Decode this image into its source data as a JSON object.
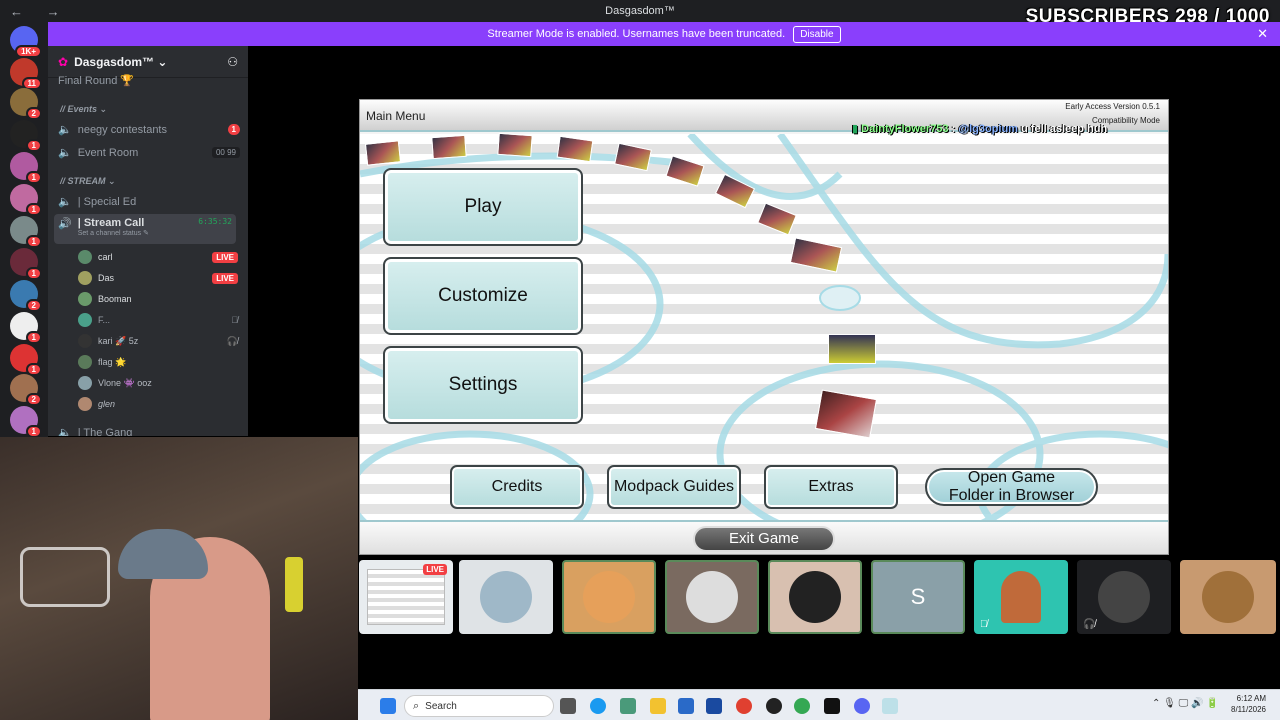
{
  "window": {
    "title": "Dasgasdom™",
    "nav_arrows": "← →"
  },
  "overlay": {
    "subscribers": "SUBSCRIBERS 298 / 1000"
  },
  "streamer_bar": {
    "text": "Streamer Mode is enabled. Usernames have been truncated.",
    "button": "Disable",
    "close": "✕"
  },
  "rail": {
    "badges": [
      "1K+",
      "11",
      "2",
      "1",
      "1",
      "1",
      "1",
      "1",
      "2",
      "1",
      "1",
      "2",
      "1"
    ]
  },
  "guild": {
    "name": "Dasgasdom™ ⌄"
  },
  "channels": {
    "final_round": "Final Round 🏆",
    "events_cat": "// Events ⌄",
    "neegy": "neegy contestants",
    "neegy_badge": "1",
    "event_room": "Event Room",
    "event_room_counts": "00  99",
    "stream_cat": "// STREAM ⌄",
    "special_ed": "|  Special Ed",
    "stream_call": "|  Stream Call",
    "stream_call_time": "6:35:32",
    "stream_call_status": "Set a channel status ✎",
    "the_gang": "|  The Gang"
  },
  "voice_users": [
    {
      "name": "carl",
      "badge": "LIVE"
    },
    {
      "name": "Das",
      "badge": "LIVE"
    },
    {
      "name": "Booman",
      "badge": ""
    },
    {
      "name": "F...",
      "badge": ""
    },
    {
      "name": "kari 🚀 5z",
      "badge": ""
    },
    {
      "name": "flag 🌟",
      "badge": ""
    },
    {
      "name": "Vlone 👾 ooz",
      "badge": ""
    },
    {
      "name": "glen",
      "badge": ""
    }
  ],
  "game": {
    "header": "Main Menu",
    "version": "Early Access Version 0.5.1",
    "mode": "Compatibility Mode",
    "chat_user": "DaintyFlower753",
    "chat_mention": "@lg3opium",
    "chat_text": "u fell asleep huh",
    "buttons": {
      "play": "Play",
      "customize": "Customize",
      "settings": "Settings",
      "credits": "Credits",
      "modpack": "Modpack Guides",
      "extras": "Extras",
      "open_folder_1": "Open Game",
      "open_folder_2": "Folder in Browser",
      "exit": "Exit Game"
    }
  },
  "participants": {
    "live_badge": "LIVE",
    "initial": "S"
  },
  "taskbar": {
    "search_placeholder": "Search",
    "time": "6:12 AM",
    "date": "8/11/2026"
  }
}
